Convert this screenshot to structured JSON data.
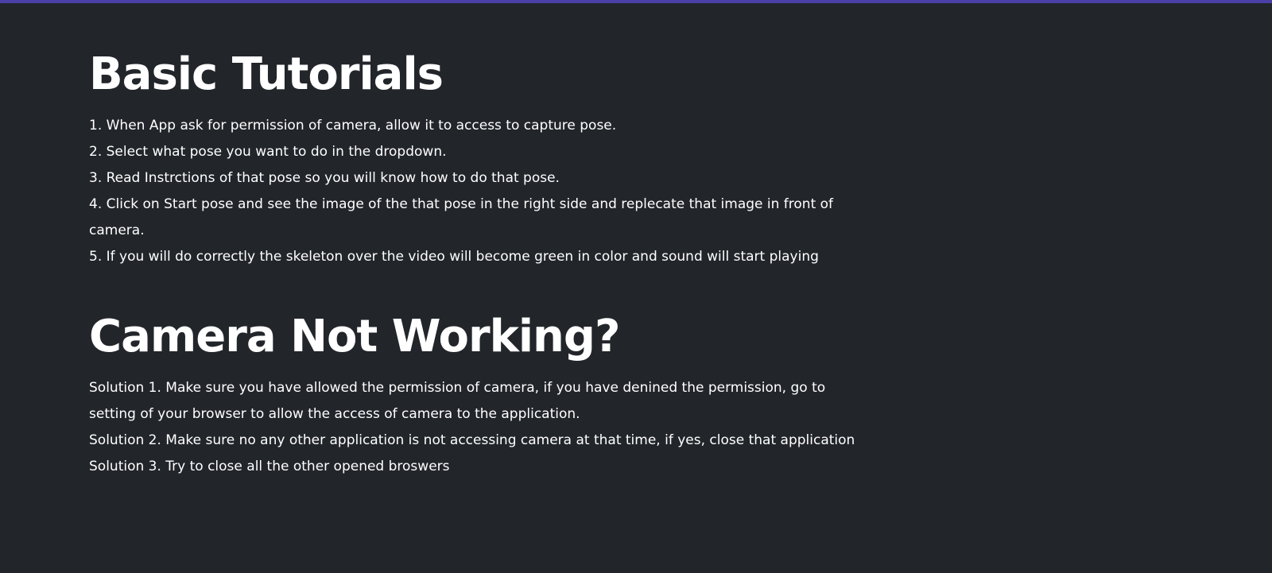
{
  "basic_tutorials": {
    "heading": "Basic Tutorials",
    "steps": [
      "1. When App ask for permission of camera, allow it to access to capture pose.",
      "2. Select what pose you want to do in the dropdown.",
      "3. Read Instrctions of that pose so you will know how to do that pose.",
      "4. Click on Start pose and see the image of the that pose in the right side and replecate that image in front of",
      "camera.",
      "5. If you will do correctly the skeleton over the video will become green in color and sound will start playing"
    ]
  },
  "camera_not_working": {
    "heading": "Camera Not Working?",
    "solutions": [
      "Solution 1. Make sure you have allowed the permission of camera, if you have denined the permission, go to",
      "setting of your browser to allow the access of camera to the application.",
      "Solution 2. Make sure no any other application is not accessing camera at that time, if yes, close that application",
      "Solution 3. Try to close all the other opened broswers"
    ]
  },
  "colors": {
    "background": "#22252a",
    "accent_bar": "#4b3fa8",
    "text": "#ffffff"
  }
}
